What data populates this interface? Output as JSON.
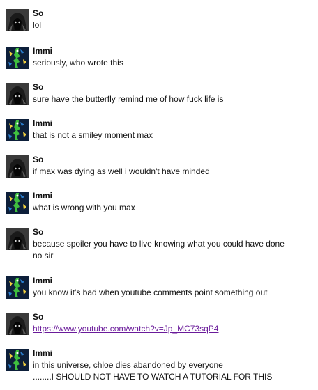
{
  "messages": [
    {
      "author": "So",
      "avatar": "hooded-figure",
      "lines": [
        "lol"
      ]
    },
    {
      "author": "Immi",
      "avatar": "green-character",
      "lines": [
        "seriously, who wrote this"
      ]
    },
    {
      "author": "So",
      "avatar": "hooded-figure",
      "lines": [
        "sure have the butterfly remind me of how fuck life is"
      ]
    },
    {
      "author": "Immi",
      "avatar": "green-character",
      "lines": [
        "that is not a smiley moment max"
      ]
    },
    {
      "author": "So",
      "avatar": "hooded-figure",
      "lines": [
        "if max was dying as well i wouldn't have minded"
      ]
    },
    {
      "author": "Immi",
      "avatar": "green-character",
      "lines": [
        "what is wrong with you max"
      ]
    },
    {
      "author": "So",
      "avatar": "hooded-figure",
      "lines": [
        "because spoiler you have to live knowing what you could have done",
        "no sir"
      ]
    },
    {
      "author": "Immi",
      "avatar": "green-character",
      "lines": [
        "you know it's bad when youtube comments point something out"
      ]
    },
    {
      "author": "So",
      "avatar": "hooded-figure",
      "lines": [
        "https://www.youtube.com/watch?v=Jp_MC73sqP4"
      ],
      "link": true
    },
    {
      "author": "Immi",
      "avatar": "green-character",
      "lines": [
        "in this universe, chloe dies abandoned by everyone",
        "........I SHOULD NOT HAVE TO WATCH A TUTORIAL FOR THIS"
      ]
    }
  ],
  "colors": {
    "link": "#6a1b9a",
    "text": "#111111"
  }
}
